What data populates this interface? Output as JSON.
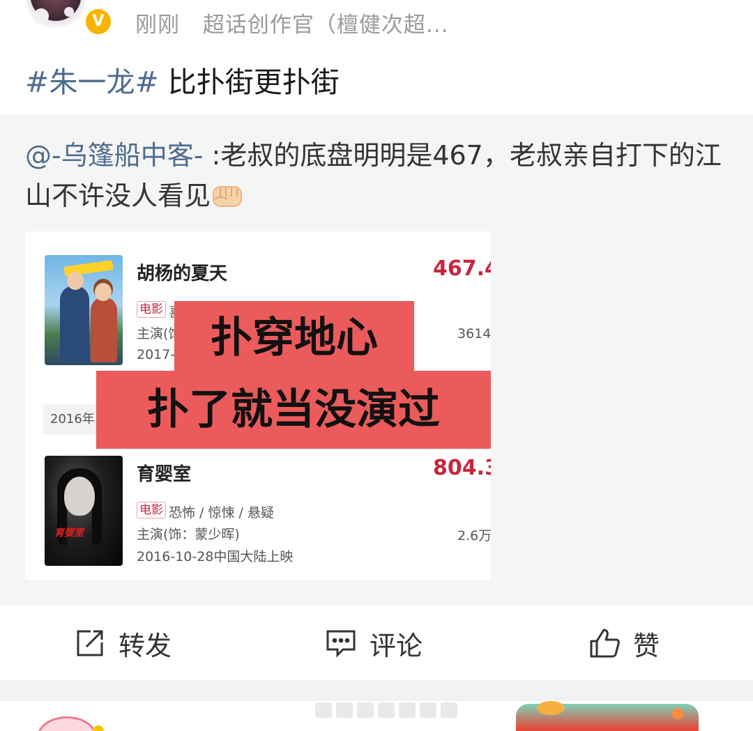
{
  "header": {
    "time": "刚刚",
    "source": "超话创作官（檀健次超..."
  },
  "post": {
    "hashtag": "#朱一龙#",
    "text": " 比扑街更扑街"
  },
  "repost": {
    "mention": "@-乌篷船中客-",
    "text": " :老叔的底盘明明是467，老叔亲自打下的江山不许没人看见",
    "emoji": "fist-emoji",
    "screenshot": {
      "movies": [
        {
          "title": "胡杨的夏天",
          "score": "467.4",
          "tag": "电影",
          "genre": "喜",
          "cast": "主演(饰",
          "release": "2017-",
          "count": "3614"
        },
        {
          "title": "育婴室",
          "score": "804.3",
          "tag": "电影",
          "genre": "恐怖 / 惊悚 / 悬疑",
          "cast": "主演(饰：蒙少晖)",
          "release": "2016-10-28中国大陆上映",
          "count": "2.6万"
        }
      ],
      "year_label": "2016年",
      "overlay": {
        "line1": "扑穿地心",
        "line2": "扑了就当没演过"
      },
      "colors": {
        "overlay_bg": "#ec5b5b",
        "score": "#c7253e"
      }
    }
  },
  "actions": {
    "repost_label": "转发",
    "comment_label": "评论",
    "like_label": "赞"
  },
  "colors": {
    "link": "#4e6b8f",
    "meta": "#9a9a9a",
    "verified": "#f7b500"
  }
}
